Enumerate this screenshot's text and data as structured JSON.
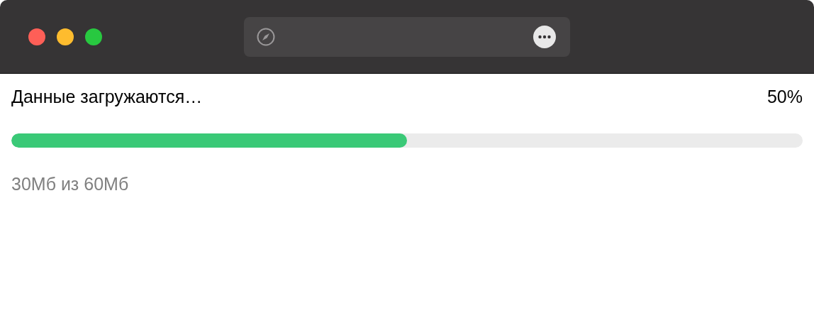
{
  "download": {
    "label": "Данные загружаются…",
    "percent": "50%",
    "level": 0.5,
    "detail": "30Мб из 60Мб"
  }
}
